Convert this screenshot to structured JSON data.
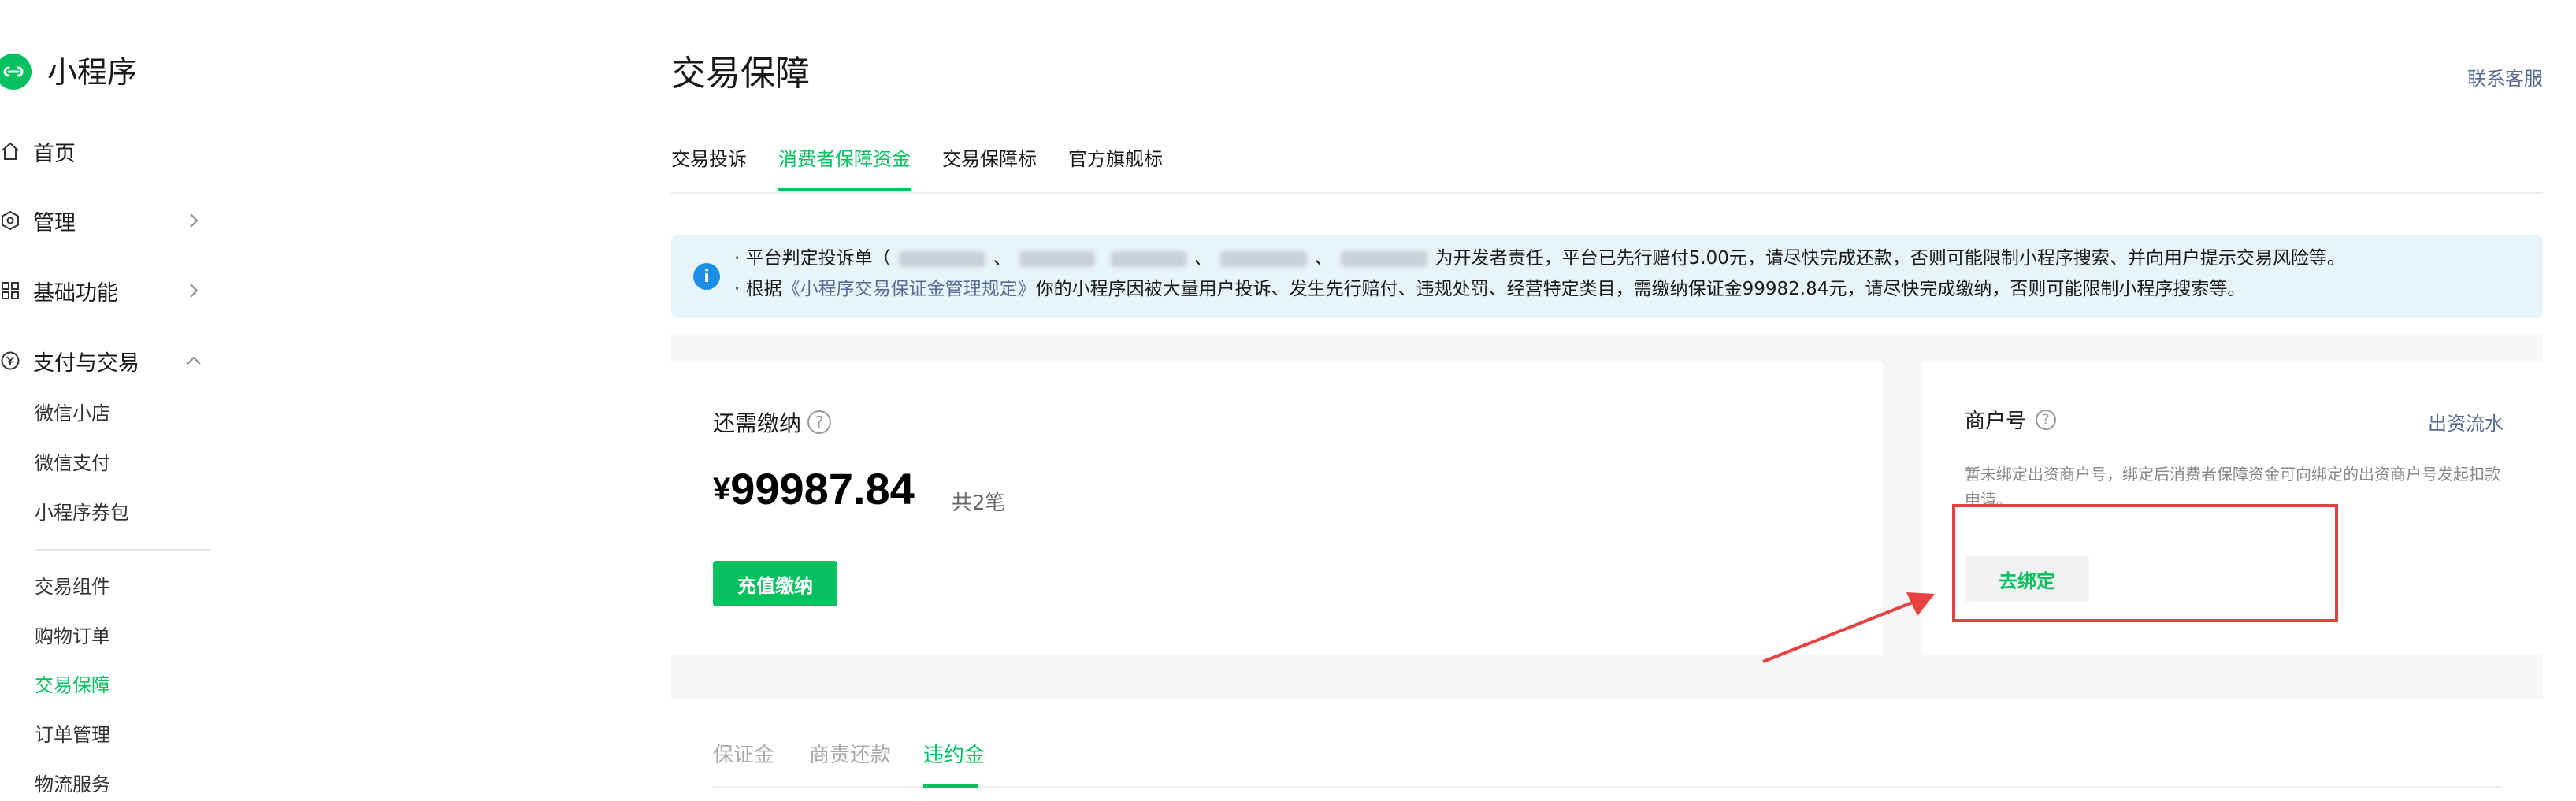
{
  "app": {
    "title": "小程序"
  },
  "sidebar": {
    "nav": [
      {
        "label": "首页",
        "icon": "home-icon"
      },
      {
        "label": "管理",
        "icon": "hexagon-icon"
      },
      {
        "label": "基础功能",
        "icon": "grid-icon"
      },
      {
        "label": "支付与交易",
        "icon": "yen-circle-icon"
      }
    ],
    "sub_items": [
      "微信小店",
      "微信支付",
      "小程序券包",
      "交易组件",
      "购物订单",
      "交易保障",
      "订单管理",
      "物流服务"
    ],
    "active_sub_item": "交易保障"
  },
  "header": {
    "title": "交易保障",
    "contact_link": "联系客服"
  },
  "tabs": [
    {
      "label": "交易投诉",
      "active": false
    },
    {
      "label": "消费者保障资金",
      "active": true
    },
    {
      "label": "交易保障标",
      "active": false
    },
    {
      "label": "官方旗舰标",
      "active": false
    }
  ],
  "notice": {
    "icon": "i",
    "line1_prefix": "· 平台判定投诉单（",
    "line1_sep1": "、",
    "line1_sep2": "、",
    "line1_sep3": "、",
    "line1_suffix": "为开发者责任，平台已先行赔付5.00元，请尽快完成还款，否则可能限制小程序搜索、并向用户提示交易风险等。",
    "line2_prefix": "· 根据",
    "line2_link": "《小程序交易保证金管理规定》",
    "line2_suffix": "你的小程序因被大量用户投诉、发生先行赔付、违规处罚、经营特定类目，需缴纳保证金99982.84元，请尽快完成缴纳，否则可能限制小程序搜索等。"
  },
  "payment_card": {
    "label": "还需缴纳",
    "help_icon": "?",
    "currency": "¥",
    "amount": "99987.84",
    "count": "共2笔",
    "button": "充值缴纳"
  },
  "merchant_card": {
    "title": "商户号",
    "help_icon": "?",
    "flow_link": "出资流水",
    "description": "暂未绑定出资商户号，绑定后消费者保障资金可向绑定的出资商户号发起扣款申请。",
    "button": "去绑定"
  },
  "bottom_tabs": [
    {
      "label": "保证金",
      "active": false
    },
    {
      "label": "商责还款",
      "active": false
    },
    {
      "label": "违约金",
      "active": true
    }
  ],
  "colors": {
    "accent": "#07c160",
    "link": "#576b95",
    "annotation": "#e94040",
    "notice_bg": "#e8f4fb"
  }
}
